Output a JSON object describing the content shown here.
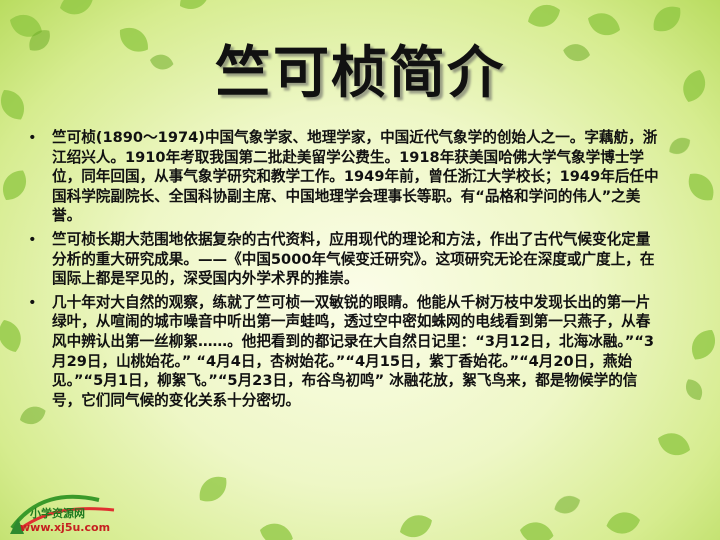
{
  "slide": {
    "title": "竺可桢简介",
    "bullets": [
      {
        "marker": "•",
        "text": "竺可桢(1890～1974)中国气象学家、地理学家，中国近代气象学的创始人之一。字藕舫，浙江绍兴人。1910年考取我国第二批赴美留学公费生。1918年获美国哈佛大学气象学博士学位，同年回国，从事气象学研究和教学工作。1949年前，曾任浙江大学校长；1949年后任中国科学院副院长、全国科协副主席、中国地理学会理事长等职。有“品格和学问的伟人”之美誉。"
      },
      {
        "marker": "•",
        "text": "竺可桢长期大范围地依据复杂的古代资料，应用现代的理论和方法，作出了古代气候变化定量分析的重大研究成果。——《中国5000年气候变迁研究》。这项研究无论在深度或广度上，在国际上都是罕见的，深受国内外学术界的推崇。"
      },
      {
        "marker": "•",
        "text": "几十年对大自然的观察，练就了竺可桢一双敏锐的眼睛。他能从千树万枝中发现长出的第一片绿叶，从喧闹的城市噪音中听出第一声蛙鸣，透过空中密如蛛网的电线看到第一只燕子，从春风中辨认出第一丝柳絮……。他把看到的都记录在大自然日记里：“3月12日，北海冰融。”“3月29日，山桃始花。” “4月4日，杏树始花。”“4月15日，紫丁香始花。”“4月20日，燕始见。”“5月1日，柳絮飞。”“5月23日，布谷鸟初鸣” 冰融花放，絮飞鸟来，都是物候学的信号，它们同气候的变化关系十分密切。"
      }
    ]
  },
  "watermark": {
    "site_name": "小学资源网",
    "url": "www.xj5u.com"
  },
  "colors": {
    "background_center": "#fbfde8",
    "background_edge": "#b9dc60",
    "leaf": "#8cc63f",
    "text": "#111111"
  }
}
